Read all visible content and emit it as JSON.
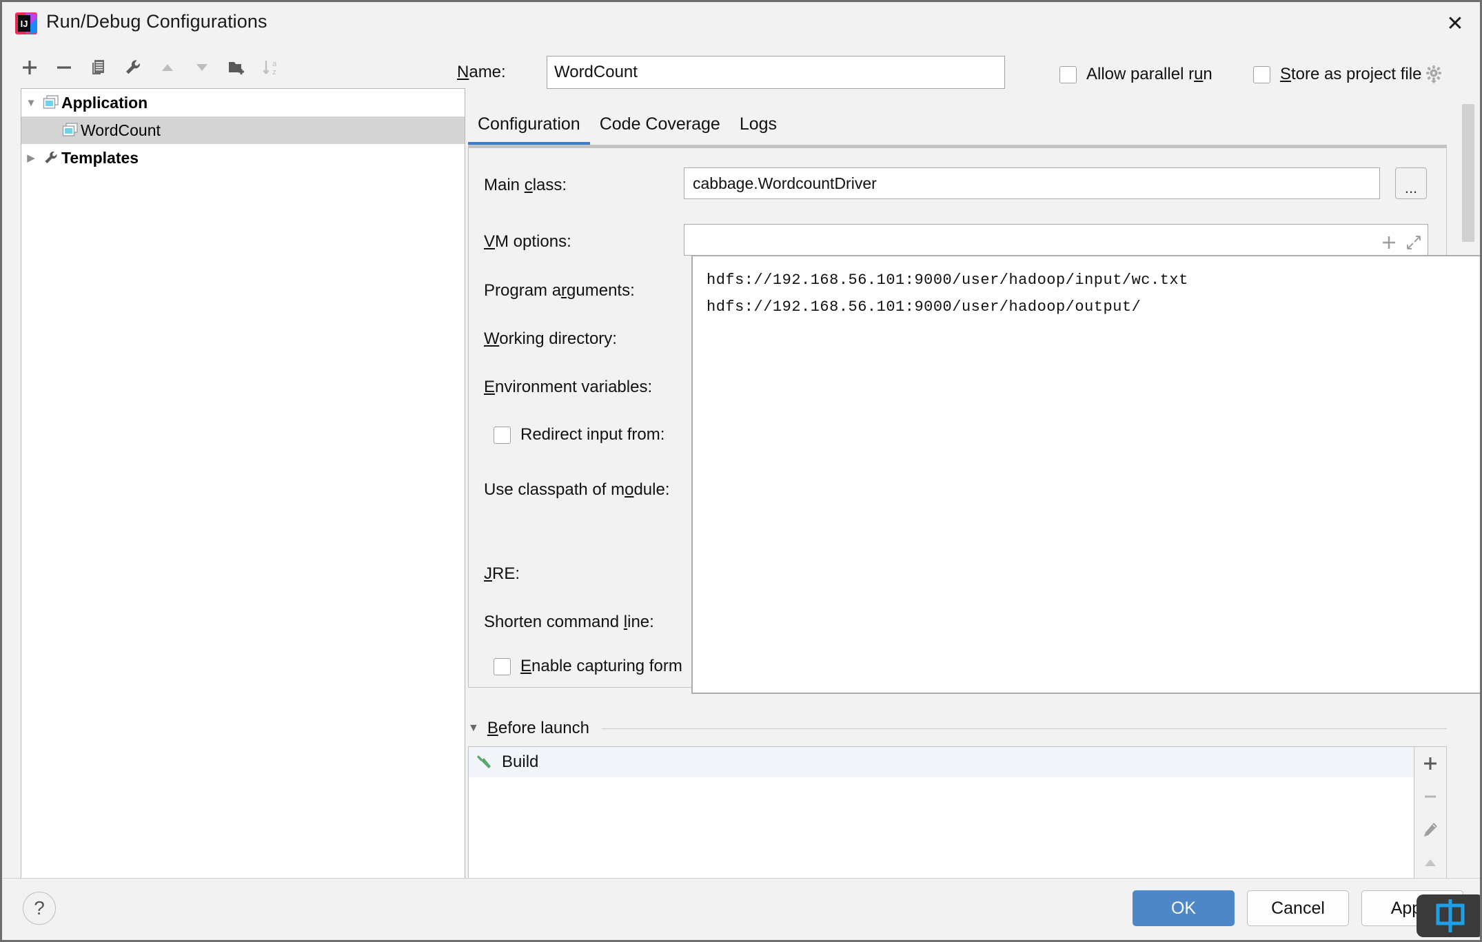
{
  "window": {
    "title": "Run/Debug Configurations",
    "logo_icon": "intellij-idea-logo",
    "close_icon": "close-icon"
  },
  "tree_toolbar": {
    "buttons": [
      {
        "name": "add-configuration-button",
        "icon": "plus-icon"
      },
      {
        "name": "remove-configuration-button",
        "icon": "minus-icon"
      },
      {
        "name": "copy-configuration-button",
        "icon": "copy-icon"
      },
      {
        "name": "edit-templates-button",
        "icon": "wrench-icon"
      },
      {
        "name": "move-up-button",
        "icon": "arrow-up-icon"
      },
      {
        "name": "move-down-button",
        "icon": "arrow-down-icon"
      },
      {
        "name": "create-folder-button",
        "icon": "folder-add-icon"
      },
      {
        "name": "sort-configurations-button",
        "icon": "sort-alpha-icon"
      }
    ]
  },
  "tree": {
    "nodes": [
      {
        "label": "Application",
        "icon": "application-icon",
        "expanded": true,
        "selected": false,
        "bold": true,
        "indent": 0,
        "twisty": "▼"
      },
      {
        "label": "WordCount",
        "icon": "application-icon",
        "expanded": false,
        "selected": true,
        "bold": false,
        "indent": 1,
        "twisty": ""
      },
      {
        "label": "Templates",
        "icon": "wrench-icon",
        "expanded": false,
        "selected": false,
        "bold": true,
        "indent": 0,
        "twisty": "▶"
      }
    ]
  },
  "name_row": {
    "label_pre": "N",
    "label_post": "ame:",
    "value": "WordCount",
    "allow_parallel_run": {
      "pre": "Allow parallel r",
      "mn": "u",
      "post": "n",
      "checked": false
    },
    "store_as_project_file": {
      "pre": "",
      "mn": "S",
      "post": "tore as project file",
      "checked": false
    },
    "gear_icon": "gear-icon"
  },
  "tabs": [
    {
      "label": "Configuration",
      "active": true
    },
    {
      "label": "Code Coverage",
      "active": false
    },
    {
      "label": "Logs",
      "active": false
    }
  ],
  "config": {
    "main_class": {
      "pre": "Main ",
      "mn": "c",
      "post": "lass:",
      "value": "cabbage.WordcountDriver",
      "browse_label": "..."
    },
    "vm_options": {
      "pre": "",
      "mn": "V",
      "post": "M options:",
      "value": "",
      "add_icon": "plus-icon",
      "expand_icon": "expand-icon"
    },
    "program_arguments": {
      "pre": "Program a",
      "mn": "r",
      "post": "guments:"
    },
    "working_directory": {
      "pre": "",
      "mn": "W",
      "post": "orking directory:"
    },
    "environment_variables": {
      "pre": "",
      "mn": "E",
      "post": "nvironment variables:"
    },
    "redirect_input_from": {
      "pre": "Redirect input from:",
      "mn": "",
      "post": "",
      "checked": false
    },
    "use_classpath_of_module": {
      "pre": "Use classpath of m",
      "mn": "o",
      "post": "dule:"
    },
    "jre": {
      "pre": "",
      "mn": "J",
      "post": "RE:"
    },
    "shorten_command_line": {
      "pre": "Shorten command ",
      "mn": "l",
      "post": "ine:"
    },
    "enable_capturing_form": {
      "pre": "",
      "mn": "E",
      "post": "nable capturing form",
      "checked": false
    }
  },
  "args_popup": {
    "lines": [
      "hdfs://192.168.56.101:9000/user/hadoop/input/wc.txt",
      "hdfs://192.168.56.101:9000/user/hadoop/output/"
    ]
  },
  "before_launch": {
    "twisty": "▼",
    "title_mn": "B",
    "title_post": "efore launch",
    "items": [
      {
        "label": "Build",
        "icon": "hammer-icon"
      }
    ],
    "side_buttons": [
      {
        "name": "add-task-button",
        "icon": "plus-icon"
      },
      {
        "name": "remove-task-button",
        "icon": "minus-icon"
      },
      {
        "name": "edit-task-button",
        "icon": "pencil-icon"
      },
      {
        "name": "move-task-up-button",
        "icon": "arrow-up-icon"
      }
    ]
  },
  "footer": {
    "help_label": "?",
    "ok_label": "OK",
    "cancel_label": "Cancel",
    "apply_label": "Apply"
  },
  "ime_overlay": {
    "glyph": "中",
    "color": "#1e9fe8"
  },
  "colors": {
    "accent": "#4d87c7",
    "tab_underline": "#3d7cc9",
    "selection": "#d4d4d4",
    "panel_bg": "#f2f2f2"
  }
}
